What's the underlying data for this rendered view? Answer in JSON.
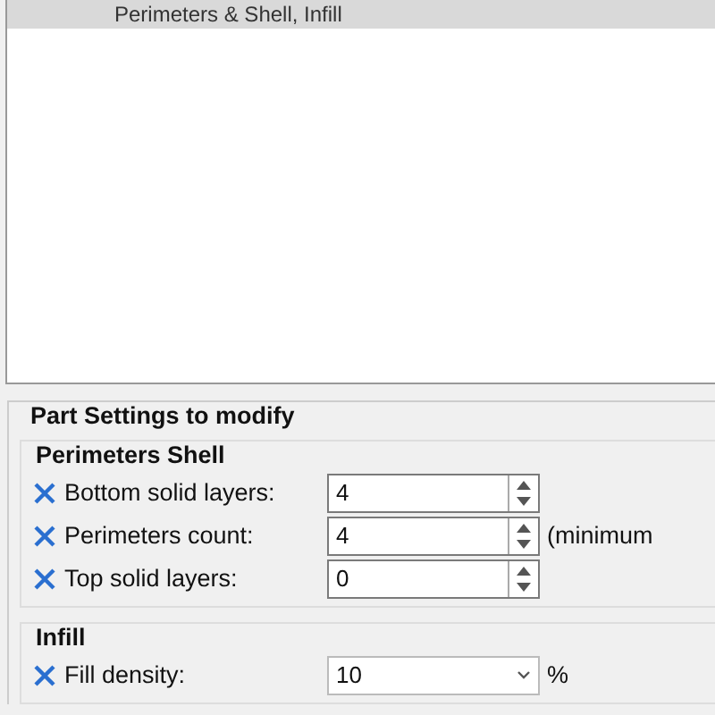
{
  "tree": {
    "items": [
      {
        "label": "Perimeters & Shell, Infill",
        "selected": true
      }
    ]
  },
  "part_settings": {
    "title": "Part Settings to modify",
    "groups": [
      {
        "title": "Perimeters  Shell",
        "rows": [
          {
            "label": "Bottom solid layers:",
            "kind": "spin",
            "value": "4"
          },
          {
            "label": "Perimeters count:",
            "kind": "spin",
            "value": "4",
            "suffix": "(minimum"
          },
          {
            "label": "Top solid layers:",
            "kind": "spin",
            "value": "0"
          }
        ]
      },
      {
        "title": "Infill",
        "rows": [
          {
            "label": "Fill density:",
            "kind": "combo",
            "value": "10",
            "suffix": "%"
          }
        ]
      }
    ]
  }
}
